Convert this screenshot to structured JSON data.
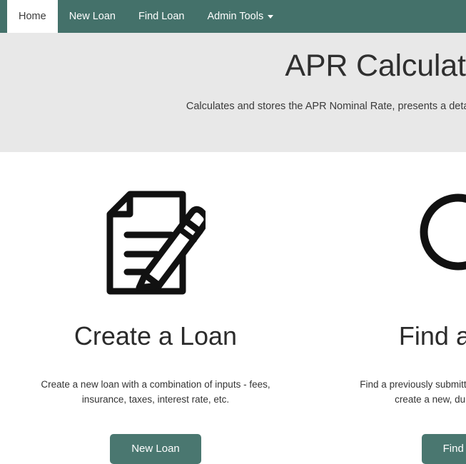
{
  "navbar": {
    "background_color": "#44716a",
    "items": [
      {
        "label": "Home",
        "active": true,
        "has_caret": false
      },
      {
        "label": "New Loan",
        "active": false,
        "has_caret": false
      },
      {
        "label": "Find Loan",
        "active": false,
        "has_caret": false
      },
      {
        "label": "Admin Tools",
        "active": false,
        "has_caret": true
      }
    ]
  },
  "jumbotron": {
    "background_color": "#e8e8e8",
    "title": "APR Calculator",
    "subtitle": "Calculates and stores the APR Nominal Rate, presents a detailed amortization schedule."
  },
  "cards": [
    {
      "icon": "document-pencil-icon",
      "title": "Create a Loan",
      "description": "Create a new loan with a combination of inputs - fees, insurance, taxes, interest rate, etc.",
      "button_label": "New Loan",
      "button_color": "#4a7770"
    },
    {
      "icon": "magnifier-icon",
      "title": "Find a Loan",
      "description": "Find a previously submitted loan to review, edit, or create a new, duplicate loan from.",
      "button_label": "Find Loan",
      "button_color": "#4a7770"
    }
  ]
}
